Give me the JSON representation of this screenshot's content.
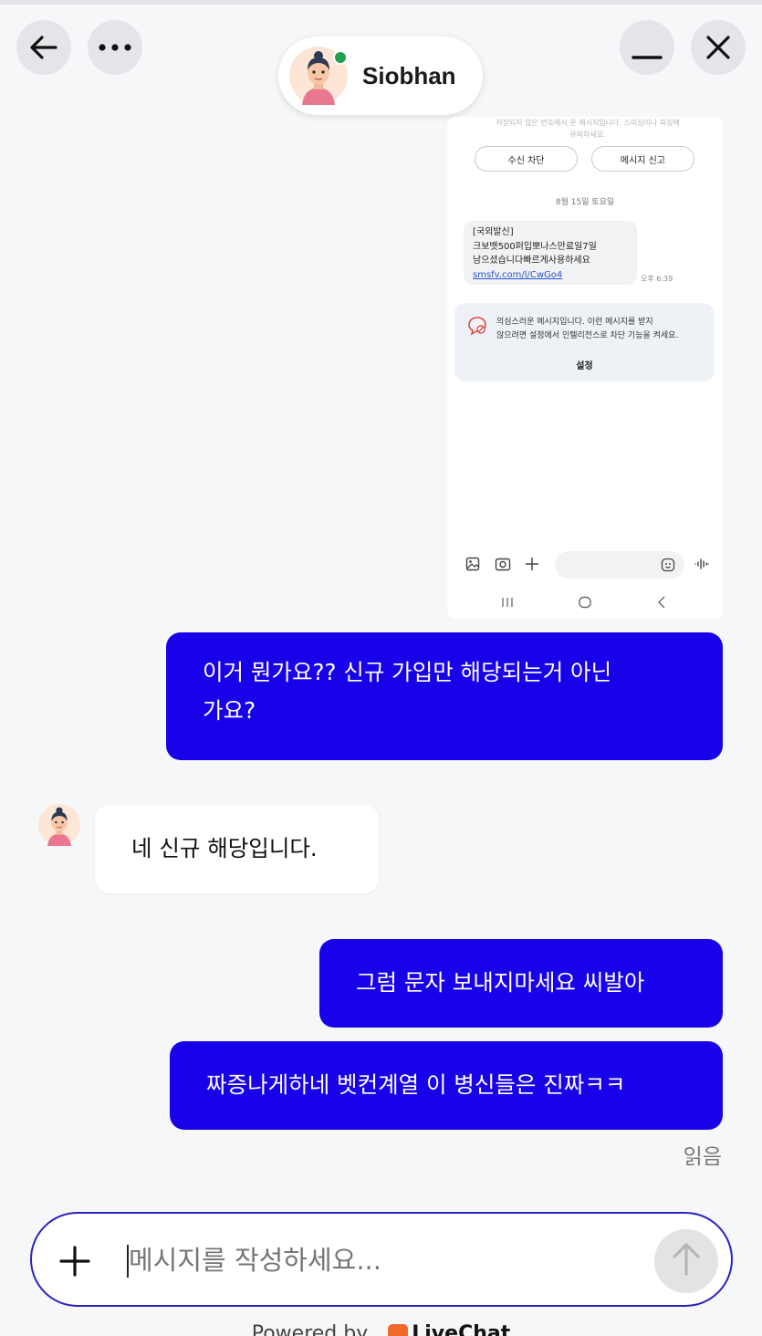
{
  "header": {
    "agent_name": "Siobhan",
    "online_color": "#20a050",
    "icons": [
      "arrow-left-icon",
      "more-horizontal-icon",
      "minimize-icon",
      "close-icon"
    ]
  },
  "screenshot": {
    "faded_notice_line1": "저장되지 않은 번호에서 온 메시지입니다. 스미싱이나 피싱에",
    "faded_notice_line2": "유의하세요.",
    "block_button": "수신 차단",
    "report_button": "메시지 신고",
    "date": "8월 15일 토요일",
    "sms_line1": "[국외발신]",
    "sms_line2": "크보뱃500퍼입뽀나스만료일7일",
    "sms_line3": "남으셨습니다빠르게사용하세요",
    "sms_link": "smsfv.com/l/CwGo4",
    "sms_time": "오후 6:39",
    "warning_line1": "의심스러운 메시지입니다. 이런 메시지를 받지",
    "warning_line2": "않으려면 설정에서 인텔리전스로 차단 기능을 켜세요.",
    "warning_settings": "설정"
  },
  "messages": [
    {
      "from": "user",
      "text_line1": "이거 뭔가요?? 신규 가입만 해당되는거 아닌",
      "text_line2": "가요?"
    },
    {
      "from": "agent",
      "text": "네 신규 해당입니다."
    },
    {
      "from": "user",
      "text": "그럼 문자 보내지마세요 씨발아"
    },
    {
      "from": "user",
      "text": "짜증나게하네 벳컨계열 이 병신들은 진짜ㅋㅋ"
    }
  ],
  "read_receipt": "읽음",
  "composer": {
    "placeholder": "메시지를 작성하세요...",
    "icons": [
      "plus-icon",
      "send-arrow-icon"
    ]
  },
  "footer": {
    "powered_by": "Powered by",
    "brand": "LiveChat"
  },
  "colors": {
    "outgoing_bubble": "#1800e8",
    "incoming_bubble": "#ffffff",
    "background": "#f6f7f9",
    "input_border": "#2a22c2"
  }
}
